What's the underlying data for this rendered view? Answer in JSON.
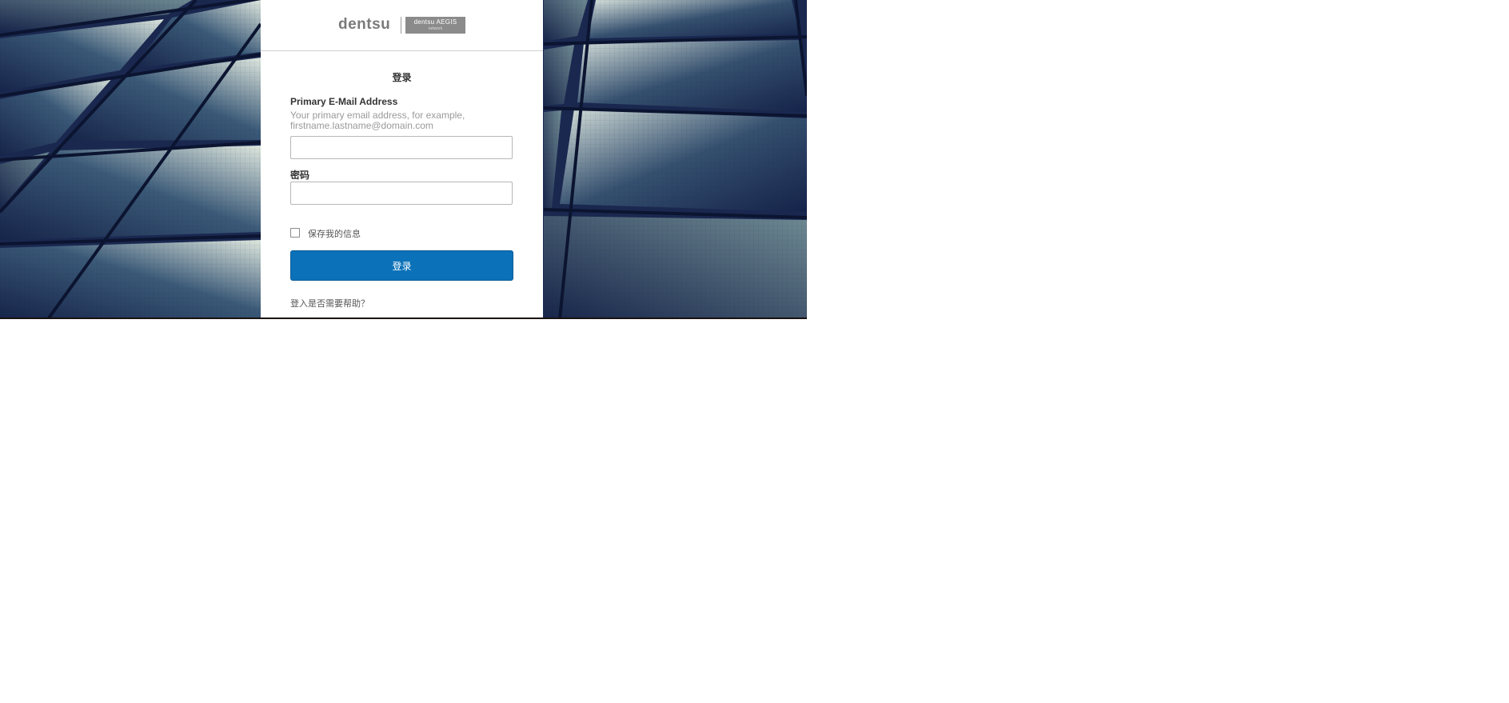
{
  "colors": {
    "accent": "#0b72b9",
    "panel_bg": "#ffffff",
    "backdrop_dark": "#1b2a4f",
    "backdrop_light": "#d8e4e0"
  },
  "logo": {
    "brand": "dentsu",
    "badge_main": "dentsu AEGIS",
    "badge_sub": "network"
  },
  "form": {
    "heading": "登录",
    "email": {
      "label": "Primary E-Mail Address",
      "hint": "Your primary email address, for example, firstname.lastname@domain.com",
      "value": "",
      "placeholder": ""
    },
    "password": {
      "label": "密码",
      "value": "",
      "placeholder": ""
    },
    "remember": {
      "label": "保存我的信息",
      "checked": false
    },
    "submit_label": "登录",
    "help_link": "登入是否需要帮助？"
  },
  "background": {
    "icon": "tiled-glass-ceiling-photo"
  }
}
